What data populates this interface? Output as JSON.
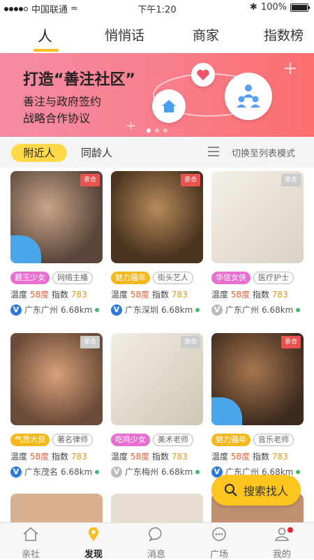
{
  "status": {
    "carrier": "中国联通",
    "time": "下午1:20",
    "battery": "100%"
  },
  "tabs": [
    "人",
    "悄悄话",
    "商家",
    "指数榜"
  ],
  "banner": {
    "title": "打造“善注社区”",
    "line1": "善注与政府签约",
    "line2": "战略合作协议"
  },
  "filter": {
    "nearby": "附近人",
    "same_age": "同龄人",
    "switch_label": "切换至列表模式"
  },
  "labels": {
    "temp": "温度",
    "index": "指数"
  },
  "cards": [
    {
      "tag": "碧玉少女",
      "tag_color": "#e86fd0",
      "job": "网络主播",
      "temp": "58度",
      "index": "783",
      "loc": "广东广州",
      "dist": "6.68km",
      "verified": true,
      "house_label": "亲合"
    },
    {
      "tag": "魅力骚年",
      "tag_color": "#f5b81c",
      "job": "街头艺人",
      "temp": "58度",
      "index": "783",
      "loc": "广东深圳",
      "dist": "6.68km",
      "verified": true,
      "house_label": "亲合"
    },
    {
      "tag": "华信女侠",
      "tag_color": "#e86fd0",
      "job": "医疗护士",
      "temp": "58度",
      "index": "783",
      "loc": "广东广州",
      "dist": "6.68km",
      "verified": false,
      "house_label": "亲合"
    },
    {
      "tag": "气质大叔",
      "tag_color": "#f5b81c",
      "job": "著名律师",
      "temp": "58度",
      "index": "783",
      "loc": "广东茂名",
      "dist": "6.68km",
      "verified": true,
      "house_label": "亲合"
    },
    {
      "tag": "吃鸡少女",
      "tag_color": "#e86fd0",
      "job": "美术老师",
      "temp": "58度",
      "index": "783",
      "loc": "广东梅州",
      "dist": "6.68km",
      "verified": false,
      "house_label": "亲合"
    },
    {
      "tag": "魅力骚年",
      "tag_color": "#f5b81c",
      "job": "音乐老师",
      "temp": "58度",
      "index": "783",
      "loc": "广东广州",
      "dist": "6.68km",
      "verified": true,
      "house_label": "亲合"
    }
  ],
  "fab": {
    "label": "搜索找人"
  },
  "tabbar": [
    "亲社",
    "发现",
    "消息",
    "广场",
    "我的"
  ]
}
